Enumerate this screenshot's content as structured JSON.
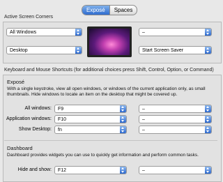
{
  "tabs": [
    "Exposé",
    "Spaces"
  ],
  "active_tab": "Exposé",
  "corners": {
    "label": "Active Screen Corners",
    "top_left": "All Windows",
    "top_right": "–",
    "bottom_left": "Desktop",
    "bottom_right_button": "Start Screen Saver"
  },
  "shortcuts": {
    "label": "Keyboard and Mouse Shortcuts (for additional choices press Shift, Control, Option, or Command)",
    "expose": {
      "heading": "Exposé",
      "description": "With a single keystroke, view all open windows, or windows of the current application only, as small thumbnails. Hide windows to locate an item on the desktop that might be covered up.",
      "rows": [
        {
          "label": "All windows:",
          "key": "F9",
          "mouse": "–"
        },
        {
          "label": "Application windows:",
          "key": "F10",
          "mouse": "–"
        },
        {
          "label": "Show Desktop:",
          "key": "fn",
          "mouse": "–"
        }
      ]
    },
    "dashboard": {
      "heading": "Dashboard",
      "description": "Dashboard provides widgets you can use to quickly get information and perform common tasks.",
      "rows": [
        {
          "label": "Hide and show:",
          "key": "F12",
          "mouse": "–"
        }
      ]
    }
  }
}
